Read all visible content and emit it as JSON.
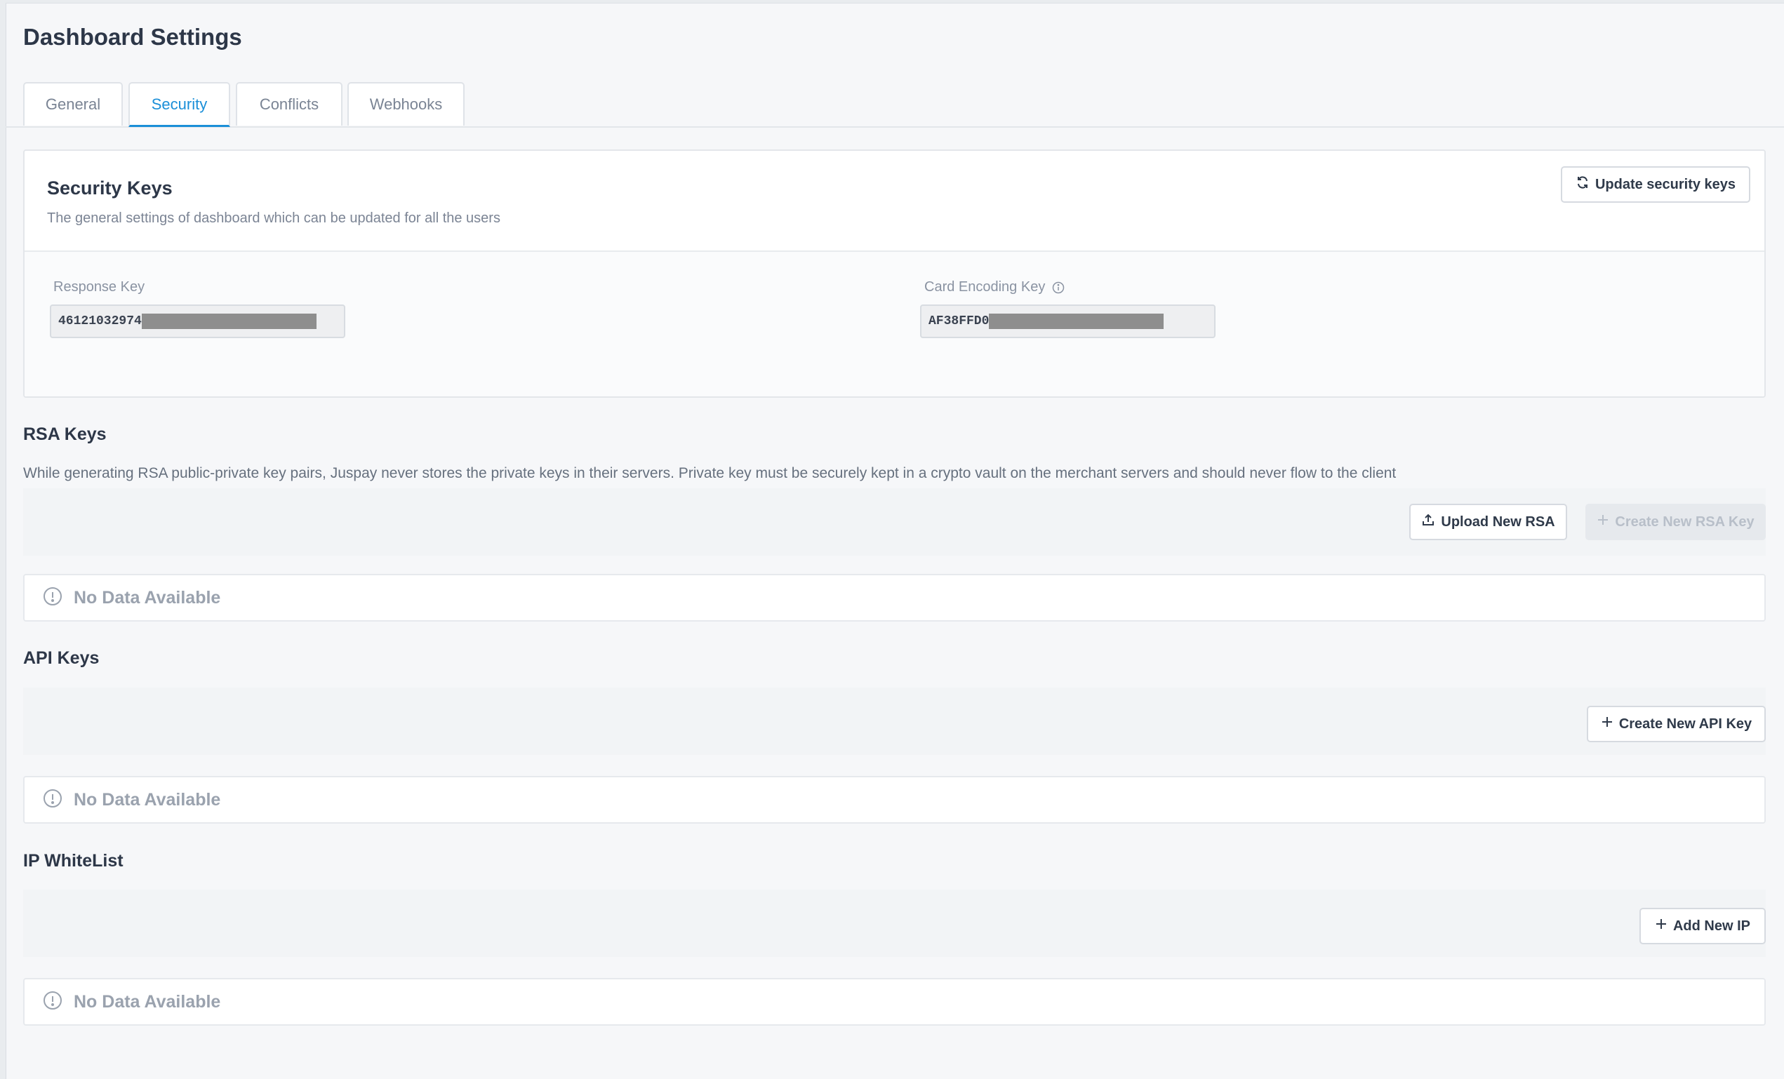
{
  "page": {
    "title": "Dashboard Settings"
  },
  "tabs": [
    {
      "label": "General",
      "active": false
    },
    {
      "label": "Security",
      "active": true
    },
    {
      "label": "Conflicts",
      "active": false
    },
    {
      "label": "Webhooks",
      "active": false
    }
  ],
  "security_keys": {
    "title": "Security Keys",
    "description": "The general settings of dashboard which can be updated for all the users",
    "update_button": "Update security keys",
    "response_key": {
      "label": "Response Key",
      "value": "46121032974"
    },
    "card_encoding_key": {
      "label": "Card Encoding Key",
      "value": "AF38FFD0"
    }
  },
  "rsa_keys": {
    "title": "RSA Keys",
    "description": "While generating RSA public-private key pairs, Juspay never stores the private keys in their servers. Private key must be securely kept in a crypto vault on the merchant servers and should never flow to the client",
    "upload_button": "Upload New RSA",
    "create_button": "Create New RSA Key",
    "empty_text": "No Data Available"
  },
  "api_keys": {
    "title": "API Keys",
    "create_button": "Create New API Key",
    "empty_text": "No Data Available"
  },
  "ip_whitelist": {
    "title": "IP WhiteList",
    "add_button": "Add New IP",
    "empty_text": "No Data Available"
  },
  "icons": {
    "refresh": "refresh-icon",
    "upload": "upload-icon",
    "plus": "plus-icon",
    "info": "info-icon",
    "alert": "alert-circle-icon"
  },
  "colors": {
    "accent": "#1b8fd8",
    "background": "#f6f7f9",
    "text": "#2d3748",
    "muted": "#9aa2ae"
  }
}
